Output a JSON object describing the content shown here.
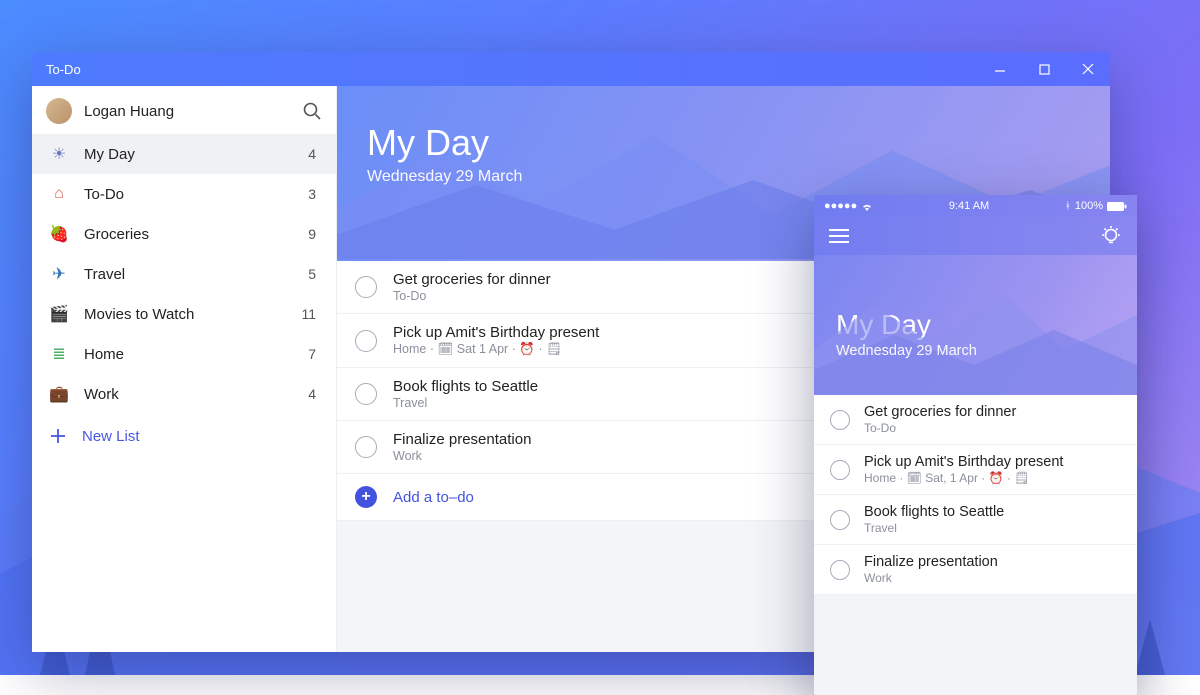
{
  "app_title": "To-Do",
  "user": {
    "name": "Logan Huang"
  },
  "sidebar": {
    "lists": [
      {
        "icon": "sun",
        "label": "My Day",
        "count": 4,
        "selected": true
      },
      {
        "icon": "home",
        "label": "To-Do",
        "count": 3
      },
      {
        "icon": "strawberry",
        "label": "Groceries",
        "count": 9
      },
      {
        "icon": "plane",
        "label": "Travel",
        "count": 5
      },
      {
        "icon": "clapboard",
        "label": "Movies to Watch",
        "count": 11
      },
      {
        "icon": "list",
        "label": "Home",
        "count": 7
      },
      {
        "icon": "briefcase",
        "label": "Work",
        "count": 4
      }
    ],
    "new_list_label": "New List"
  },
  "main": {
    "title": "My Day",
    "date": "Wednesday 29 March",
    "tasks": [
      {
        "title": "Get groceries for dinner",
        "meta": "To-Do"
      },
      {
        "title": "Pick up Amit's Birthday present",
        "meta": "Home  ·  🗓 Sat 1 Apr  ·  ⏰  ·  🗒"
      },
      {
        "title": "Book flights to Seattle",
        "meta": "Travel"
      },
      {
        "title": "Finalize presentation",
        "meta": "Work"
      }
    ],
    "add_label": "Add a to–do"
  },
  "mobile": {
    "status": {
      "time": "9:41 AM",
      "battery": "100%"
    },
    "title": "My Day",
    "date": "Wednesday 29 March",
    "tasks": [
      {
        "title": "Get groceries for dinner",
        "meta": "To-Do"
      },
      {
        "title": "Pick up Amit's Birthday present",
        "meta": "Home · 🗓 Sat, 1 Apr · ⏰ · 🗒"
      },
      {
        "title": "Book flights to Seattle",
        "meta": "Travel"
      },
      {
        "title": "Finalize presentation",
        "meta": "Work"
      }
    ]
  },
  "icons": {
    "sun": "☀",
    "home": "⌂",
    "strawberry": "🍓",
    "plane": "✈",
    "clapboard": "🎬",
    "list": "≣",
    "briefcase": "💼"
  }
}
